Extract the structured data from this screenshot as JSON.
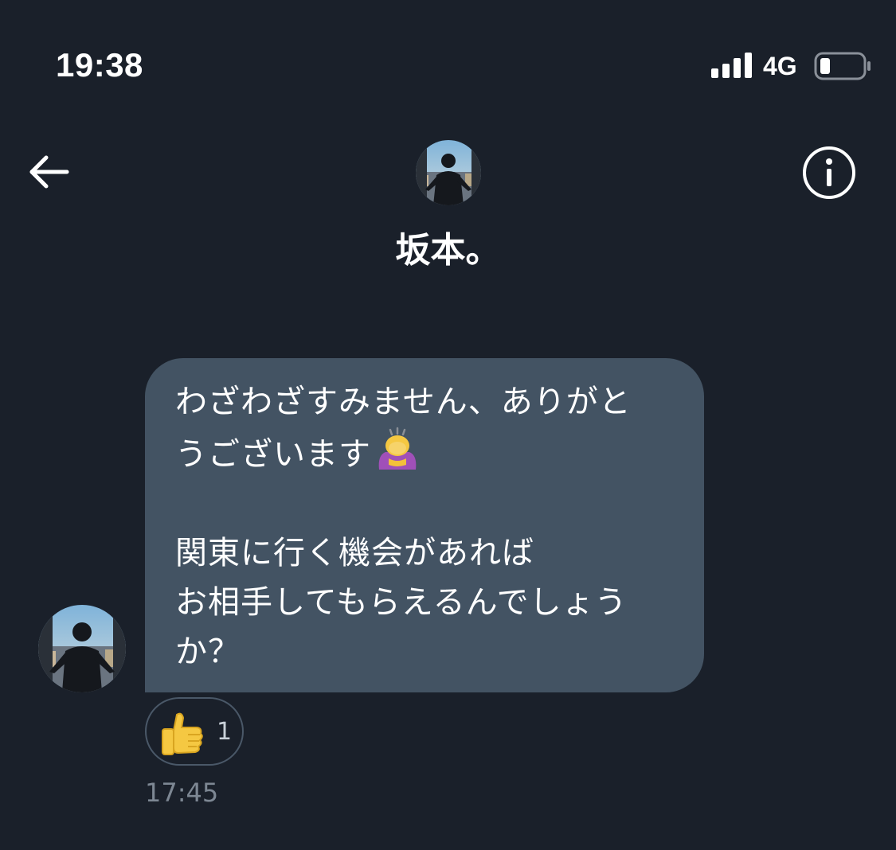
{
  "status_bar": {
    "time": "19:38",
    "network": "4G",
    "signal_icon": "signal-bars-icon",
    "battery_icon": "battery-low-icon"
  },
  "header": {
    "back_icon": "arrow-left-icon",
    "info_icon": "info-circle-icon",
    "contact_name": "坂本。"
  },
  "message": {
    "line1": "わざわざすみません、ありがと",
    "line2": "うございます",
    "emoji_icon": "person-bowing-icon",
    "line3": "関東に行く機会があれば",
    "line4": "お相手してもらえるんでしょう",
    "line5": "か？",
    "reaction": {
      "icon": "thumbs-up-icon",
      "count": "1"
    },
    "timestamp": "17:45"
  },
  "colors": {
    "background": "#1a202a",
    "bubble": "#435363",
    "timestamp": "#7d8793"
  }
}
